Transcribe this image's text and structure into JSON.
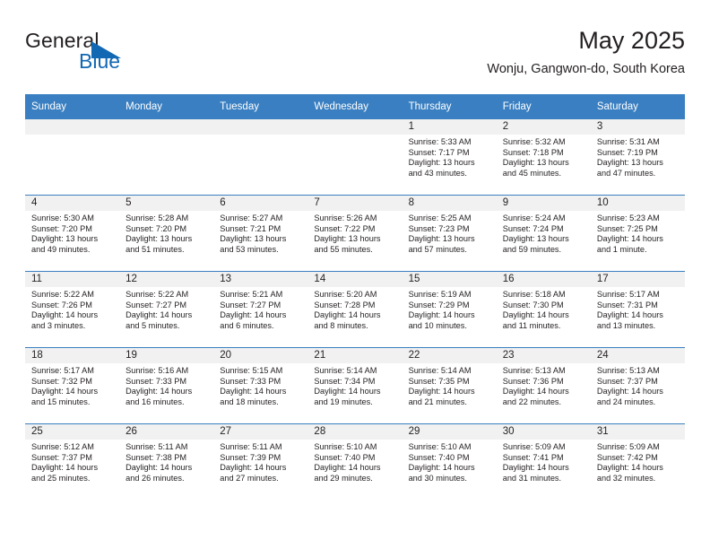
{
  "brand": {
    "name_top": "General",
    "name_bottom": "Blue",
    "accent_color": "#1268b3",
    "triangle_icon": "triangle-icon"
  },
  "header": {
    "title": "May 2025",
    "subtitle": "Wonju, Gangwon-do, South Korea"
  },
  "theme": {
    "header_bg": "#3a7fc1",
    "header_text": "#ffffff",
    "daynum_band_bg": "#f1f1f1",
    "body_text": "#231f20"
  },
  "calendar": {
    "weekday_headers": [
      "Sunday",
      "Monday",
      "Tuesday",
      "Wednesday",
      "Thursday",
      "Friday",
      "Saturday"
    ],
    "weeks": [
      [
        {
          "day": "",
          "lines": []
        },
        {
          "day": "",
          "lines": []
        },
        {
          "day": "",
          "lines": []
        },
        {
          "day": "",
          "lines": []
        },
        {
          "day": "1",
          "lines": [
            "Sunrise: 5:33 AM",
            "Sunset: 7:17 PM",
            "Daylight: 13 hours",
            "and 43 minutes."
          ]
        },
        {
          "day": "2",
          "lines": [
            "Sunrise: 5:32 AM",
            "Sunset: 7:18 PM",
            "Daylight: 13 hours",
            "and 45 minutes."
          ]
        },
        {
          "day": "3",
          "lines": [
            "Sunrise: 5:31 AM",
            "Sunset: 7:19 PM",
            "Daylight: 13 hours",
            "and 47 minutes."
          ]
        }
      ],
      [
        {
          "day": "4",
          "lines": [
            "Sunrise: 5:30 AM",
            "Sunset: 7:20 PM",
            "Daylight: 13 hours",
            "and 49 minutes."
          ]
        },
        {
          "day": "5",
          "lines": [
            "Sunrise: 5:28 AM",
            "Sunset: 7:20 PM",
            "Daylight: 13 hours",
            "and 51 minutes."
          ]
        },
        {
          "day": "6",
          "lines": [
            "Sunrise: 5:27 AM",
            "Sunset: 7:21 PM",
            "Daylight: 13 hours",
            "and 53 minutes."
          ]
        },
        {
          "day": "7",
          "lines": [
            "Sunrise: 5:26 AM",
            "Sunset: 7:22 PM",
            "Daylight: 13 hours",
            "and 55 minutes."
          ]
        },
        {
          "day": "8",
          "lines": [
            "Sunrise: 5:25 AM",
            "Sunset: 7:23 PM",
            "Daylight: 13 hours",
            "and 57 minutes."
          ]
        },
        {
          "day": "9",
          "lines": [
            "Sunrise: 5:24 AM",
            "Sunset: 7:24 PM",
            "Daylight: 13 hours",
            "and 59 minutes."
          ]
        },
        {
          "day": "10",
          "lines": [
            "Sunrise: 5:23 AM",
            "Sunset: 7:25 PM",
            "Daylight: 14 hours",
            "and 1 minute."
          ]
        }
      ],
      [
        {
          "day": "11",
          "lines": [
            "Sunrise: 5:22 AM",
            "Sunset: 7:26 PM",
            "Daylight: 14 hours",
            "and 3 minutes."
          ]
        },
        {
          "day": "12",
          "lines": [
            "Sunrise: 5:22 AM",
            "Sunset: 7:27 PM",
            "Daylight: 14 hours",
            "and 5 minutes."
          ]
        },
        {
          "day": "13",
          "lines": [
            "Sunrise: 5:21 AM",
            "Sunset: 7:27 PM",
            "Daylight: 14 hours",
            "and 6 minutes."
          ]
        },
        {
          "day": "14",
          "lines": [
            "Sunrise: 5:20 AM",
            "Sunset: 7:28 PM",
            "Daylight: 14 hours",
            "and 8 minutes."
          ]
        },
        {
          "day": "15",
          "lines": [
            "Sunrise: 5:19 AM",
            "Sunset: 7:29 PM",
            "Daylight: 14 hours",
            "and 10 minutes."
          ]
        },
        {
          "day": "16",
          "lines": [
            "Sunrise: 5:18 AM",
            "Sunset: 7:30 PM",
            "Daylight: 14 hours",
            "and 11 minutes."
          ]
        },
        {
          "day": "17",
          "lines": [
            "Sunrise: 5:17 AM",
            "Sunset: 7:31 PM",
            "Daylight: 14 hours",
            "and 13 minutes."
          ]
        }
      ],
      [
        {
          "day": "18",
          "lines": [
            "Sunrise: 5:17 AM",
            "Sunset: 7:32 PM",
            "Daylight: 14 hours",
            "and 15 minutes."
          ]
        },
        {
          "day": "19",
          "lines": [
            "Sunrise: 5:16 AM",
            "Sunset: 7:33 PM",
            "Daylight: 14 hours",
            "and 16 minutes."
          ]
        },
        {
          "day": "20",
          "lines": [
            "Sunrise: 5:15 AM",
            "Sunset: 7:33 PM",
            "Daylight: 14 hours",
            "and 18 minutes."
          ]
        },
        {
          "day": "21",
          "lines": [
            "Sunrise: 5:14 AM",
            "Sunset: 7:34 PM",
            "Daylight: 14 hours",
            "and 19 minutes."
          ]
        },
        {
          "day": "22",
          "lines": [
            "Sunrise: 5:14 AM",
            "Sunset: 7:35 PM",
            "Daylight: 14 hours",
            "and 21 minutes."
          ]
        },
        {
          "day": "23",
          "lines": [
            "Sunrise: 5:13 AM",
            "Sunset: 7:36 PM",
            "Daylight: 14 hours",
            "and 22 minutes."
          ]
        },
        {
          "day": "24",
          "lines": [
            "Sunrise: 5:13 AM",
            "Sunset: 7:37 PM",
            "Daylight: 14 hours",
            "and 24 minutes."
          ]
        }
      ],
      [
        {
          "day": "25",
          "lines": [
            "Sunrise: 5:12 AM",
            "Sunset: 7:37 PM",
            "Daylight: 14 hours",
            "and 25 minutes."
          ]
        },
        {
          "day": "26",
          "lines": [
            "Sunrise: 5:11 AM",
            "Sunset: 7:38 PM",
            "Daylight: 14 hours",
            "and 26 minutes."
          ]
        },
        {
          "day": "27",
          "lines": [
            "Sunrise: 5:11 AM",
            "Sunset: 7:39 PM",
            "Daylight: 14 hours",
            "and 27 minutes."
          ]
        },
        {
          "day": "28",
          "lines": [
            "Sunrise: 5:10 AM",
            "Sunset: 7:40 PM",
            "Daylight: 14 hours",
            "and 29 minutes."
          ]
        },
        {
          "day": "29",
          "lines": [
            "Sunrise: 5:10 AM",
            "Sunset: 7:40 PM",
            "Daylight: 14 hours",
            "and 30 minutes."
          ]
        },
        {
          "day": "30",
          "lines": [
            "Sunrise: 5:09 AM",
            "Sunset: 7:41 PM",
            "Daylight: 14 hours",
            "and 31 minutes."
          ]
        },
        {
          "day": "31",
          "lines": [
            "Sunrise: 5:09 AM",
            "Sunset: 7:42 PM",
            "Daylight: 14 hours",
            "and 32 minutes."
          ]
        }
      ]
    ]
  }
}
